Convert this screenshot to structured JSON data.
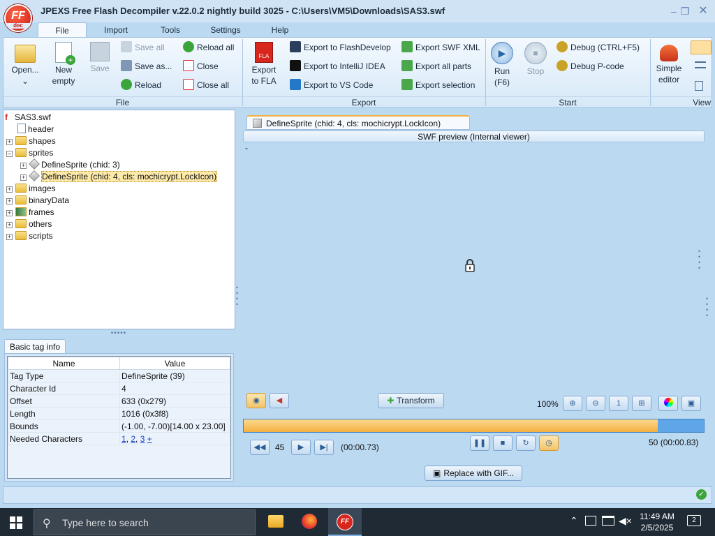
{
  "window": {
    "title": "JPEXS Free Flash Decompiler v.22.0.2 nightly build 3025 - C:\\Users\\VM5\\Downloads\\SAS3.swf",
    "logo_text": "FF",
    "logo_sub": "dec"
  },
  "menu_tabs": [
    "File",
    "Import",
    "Tools",
    "Settings",
    "Help"
  ],
  "ribbon": {
    "file_group": {
      "label": "File",
      "open": "Open...",
      "new_empty_1": "New",
      "new_empty_2": "empty",
      "save": "Save",
      "save_all": "Save all",
      "save_as": "Save as...",
      "reload": "Reload",
      "reload_all": "Reload all",
      "close": "Close",
      "close_all": "Close all"
    },
    "export_group": {
      "label": "Export",
      "export_fla_1": "Export",
      "export_fla_2": "to FLA",
      "fla_badge": "FLA",
      "flashdevelop": "Export to FlashDevelop",
      "intellij": "Export to IntelliJ IDEA",
      "vscode": "Export to VS Code",
      "swf_xml": "Export SWF XML",
      "all_parts": "Export all parts",
      "selection": "Export selection"
    },
    "start_group": {
      "label": "Start",
      "run_1": "Run",
      "run_2": "(F6)",
      "stop": "Stop",
      "debug": "Debug (CTRL+F5)",
      "debug_pcode": "Debug P-code"
    },
    "view_group": {
      "label": "View",
      "simple_1": "Simple",
      "simple_2": "editor"
    }
  },
  "tree": {
    "root": "SAS3.swf",
    "items": [
      "header",
      "shapes",
      "sprites",
      "DefineSprite (chid: 3)",
      "DefineSprite (chid: 4, cls: mochicrypt.LockIcon)",
      "images",
      "binaryData",
      "frames",
      "others",
      "scripts"
    ]
  },
  "info_panel": {
    "tab": "Basic tag info",
    "col_name": "Name",
    "col_value": "Value",
    "rows": [
      {
        "name": "Tag Type",
        "value": "DefineSprite (39)"
      },
      {
        "name": "Character Id",
        "value": "4"
      },
      {
        "name": "Offset",
        "value": "633 (0x279)"
      },
      {
        "name": "Length",
        "value": "1016 (0x3f8)"
      },
      {
        "name": "Bounds",
        "value": "(-1.00, -7.00)[14.00 x 23.00]"
      }
    ],
    "needed_label": "Needed Characters",
    "needed_links": [
      "1",
      "2",
      "3",
      "+"
    ]
  },
  "preview": {
    "tab_title": "DefineSprite (chid: 4, cls: mochicrypt.LockIcon)",
    "header": "SWF preview (Internal viewer)",
    "dash": "-",
    "transform": "Transform",
    "zoom": "100%",
    "frame_current": "45",
    "time_current": "(00:00.73)",
    "frame_total": "50",
    "time_total": "(00:00.83)",
    "progress": 0.9,
    "replace_gif": "Replace with GIF..."
  },
  "taskbar": {
    "search_placeholder": "Type here to search",
    "time": "11:49 AM",
    "date": "2/5/2025",
    "notifications": "2"
  },
  "colors": {
    "accent": "#f5b041",
    "ribbon_bg": "#d6e8f8",
    "taskbar": "#1f2a35"
  }
}
